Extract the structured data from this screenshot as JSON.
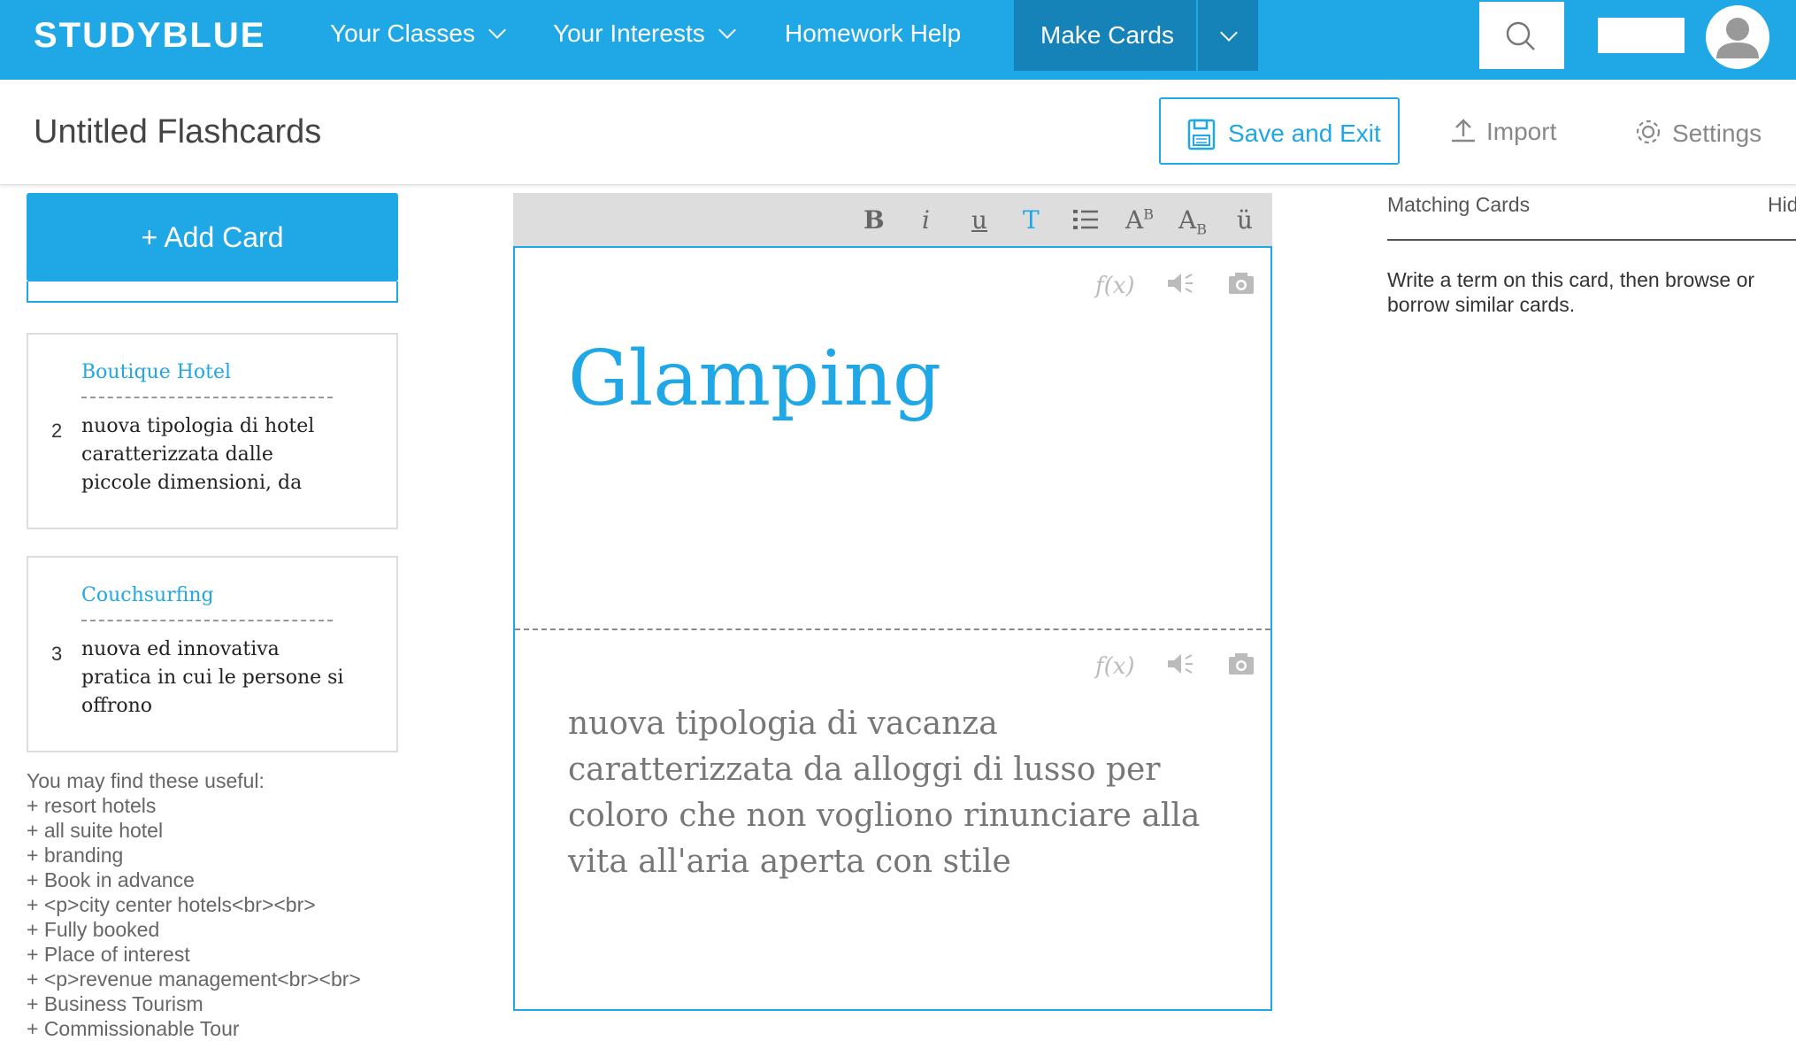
{
  "header": {
    "logo": "STUDYBLUE",
    "nav": [
      {
        "label": "Your Classes"
      },
      {
        "label": "Your Interests"
      },
      {
        "label": "Homework Help"
      }
    ],
    "make_cards": "Make Cards"
  },
  "page": {
    "title": "Untitled Flashcards",
    "save_label": "Save and Exit",
    "import_label": "Import",
    "settings_label": "Settings"
  },
  "sidebar": {
    "add_card": "+ Add Card",
    "cards": [
      {
        "number": "2",
        "term": "Boutique Hotel",
        "definition": "nuova tipologia di hotel caratterizzata dalle piccole dimensioni, da"
      },
      {
        "number": "3",
        "term": "Couchsurfing",
        "definition": "nuova ed innovativa pratica in cui le persone si offrono"
      }
    ],
    "useful_heading": "You may find these useful:",
    "useful": [
      "+ resort hotels",
      "+ all suite hotel",
      "+ branding",
      "+ Book in advance",
      "+ <p>city center hotels<br><br>",
      "+ Fully booked",
      "+ Place of interest",
      "+ <p>revenue management<br><br>",
      "+ Business Tourism",
      "+ Commissionable Tour"
    ]
  },
  "toolbar": {
    "bold": "B",
    "italic": "i",
    "underline": "u",
    "text": "T",
    "superscript": "A",
    "superscript_mark": "B",
    "subscript": "A",
    "subscript_mark": "B",
    "umlaut": "ü"
  },
  "editor": {
    "front_text": "Glamping",
    "back_text": "nuova tipologia di vacanza caratterizzata da alloggi di lusso per coloro che non vogliono rinunciare alla vita all'aria aperta con stile",
    "formula_label": "f(x)"
  },
  "right_panel": {
    "heading": "Matching Cards",
    "hide": "Hid",
    "hint": "Write a term on this card, then browse or borrow similar cards."
  },
  "colors": {
    "brand": "#1fa7e6",
    "brand_dark": "#1582b8"
  }
}
